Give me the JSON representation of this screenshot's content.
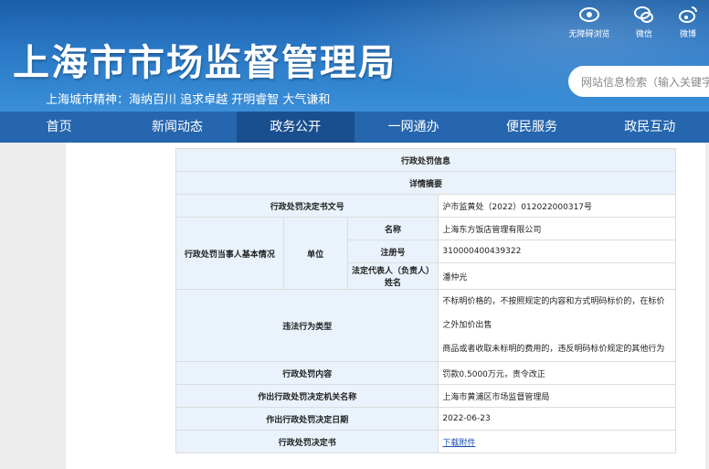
{
  "header": {
    "title": "上海市市场监督管理局",
    "motto": "上海城市精神：海纳百川  追求卓越    开明睿智  大气谦和",
    "search_placeholder": "网站信息检索（输入关键字",
    "tools": [
      {
        "label": "无障碍浏览",
        "icon": "accessibility-icon"
      },
      {
        "label": "微信",
        "icon": "wechat-icon"
      },
      {
        "label": "微博",
        "icon": "weibo-icon"
      }
    ]
  },
  "nav": [
    "首页",
    "新闻动态",
    "政务公开",
    "一网通办",
    "便民服务",
    "政民互动"
  ],
  "table": {
    "title": "行政处罚信息",
    "subtitle": "详情摘要",
    "doc_no_label": "行政处罚决定书文号",
    "doc_no": "沪市监黄处（2022）012022000317号",
    "party_label": "行政处罚当事人基本情况",
    "unit_label": "单位",
    "name_label": "名称",
    "name": "上海东方饭店管理有限公司",
    "reg_label": "注册号",
    "reg": "310000400439322",
    "rep_label": "法定代表人（负责人）姓名",
    "rep": "潘仲光",
    "violation_label": "违法行为类型",
    "violation_line1": "不标明价格的，不按照规定的内容和方式明码标价的，在标价之外加价出售",
    "violation_line2": "商品或者收取未标明的费用的，违反明码标价规定的其他行为",
    "penalty_label": "行政处罚内容",
    "penalty": "罚款0.5000万元，责令改正",
    "authority_label": "作出行政处罚决定机关名称",
    "authority": "上海市黄浦区市场监督管理局",
    "date_label": "作出行政处罚决定日期",
    "date": "2022-06-23",
    "decision_label": "行政处罚决定书",
    "decision_link": "下载附件"
  }
}
